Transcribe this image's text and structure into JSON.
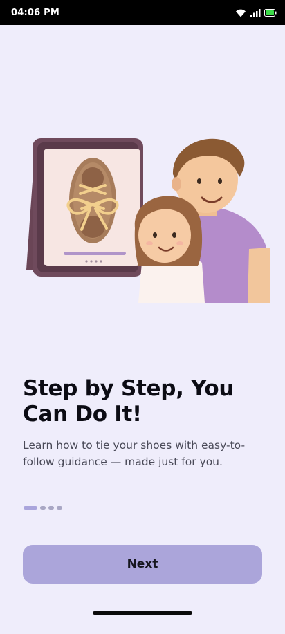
{
  "status_bar": {
    "time": "04:06 PM",
    "icons": [
      "wifi-icon",
      "cell-signal-icon",
      "battery-icon"
    ],
    "battery_color": "#3ddc4a"
  },
  "onboarding": {
    "title": "Step by Step, You Can Do It!",
    "subtitle": "Learn how to tie your shoes with easy-to-follow guidance — made just for you.",
    "page_indicator": {
      "total": 4,
      "current": 1
    },
    "next_label": "Next",
    "illustration": "parent-and-child-with-tablet-showing-shoe-lacing"
  },
  "colors": {
    "background": "#efedfb",
    "accent": "#aba5da",
    "text_primary": "#0c0c14",
    "text_secondary": "#4a4a58"
  }
}
